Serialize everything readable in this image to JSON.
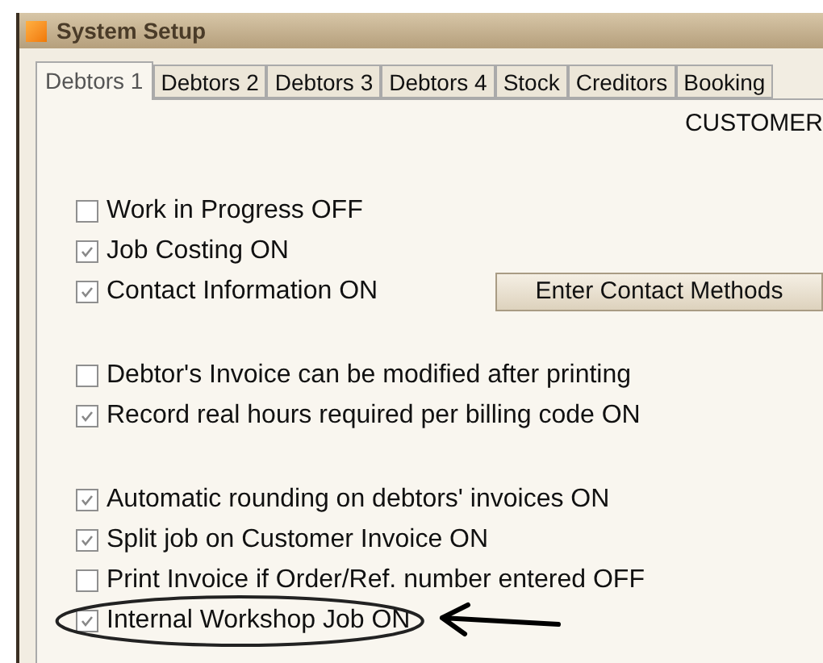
{
  "window": {
    "title": "System Setup"
  },
  "tabs": [
    {
      "label": "Debtors 1",
      "selected": true
    },
    {
      "label": "Debtors 2",
      "selected": false
    },
    {
      "label": "Debtors 3",
      "selected": false
    },
    {
      "label": "Debtors 4",
      "selected": false
    },
    {
      "label": "Stock",
      "selected": false
    },
    {
      "label": "Creditors",
      "selected": false
    },
    {
      "label": "Booking",
      "selected": false
    }
  ],
  "section_heading": "CUSTOMER",
  "groups": [
    [
      {
        "label": "Work in Progress OFF",
        "checked": false,
        "highlighted": false
      },
      {
        "label": "Job Costing ON",
        "checked": true,
        "highlighted": false
      },
      {
        "label": "Contact Information ON",
        "checked": true,
        "highlighted": false,
        "button": "Enter Contact Methods"
      }
    ],
    [
      {
        "label": "Debtor's Invoice can be modified after printing",
        "checked": false,
        "highlighted": false
      },
      {
        "label": "Record real hours required per billing code ON",
        "checked": true,
        "highlighted": false
      }
    ],
    [
      {
        "label": "Automatic rounding on debtors' invoices ON",
        "checked": true,
        "highlighted": false
      },
      {
        "label": "Split job on Customer Invoice ON",
        "checked": true,
        "highlighted": false
      },
      {
        "label": "Print Invoice if Order/Ref. number entered OFF",
        "checked": false,
        "highlighted": false
      },
      {
        "label": "Internal Workshop Job ON",
        "checked": true,
        "highlighted": true
      }
    ]
  ]
}
